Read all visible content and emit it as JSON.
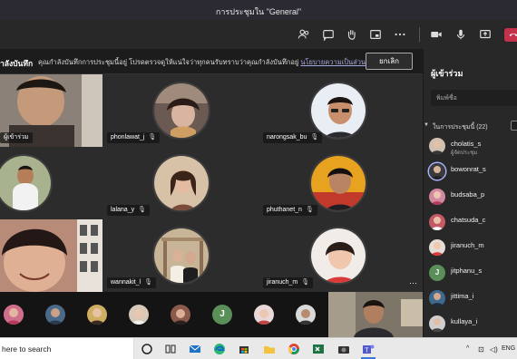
{
  "window": {
    "title": "การประชุมใน \"General\""
  },
  "toolbar": {
    "icons": [
      "participants-icon",
      "chat-icon",
      "raise-hand-icon",
      "breakout-rooms-icon",
      "more-actions-icon",
      "camera-icon",
      "microphone-icon",
      "share-screen-icon",
      "leave-call-icon"
    ],
    "hangup_color": "#c4314b"
  },
  "banner": {
    "bold_text": "ำลังบันทึก",
    "message": "คุณกำลังบันทึกการประชุมนี้อยู่ โปรดตรวจดูให้แน่ใจว่าทุกคนรับทราบว่าคุณกำลังบันทึกอยู่",
    "link": "นโยบายความเป็นส่วนตัว",
    "dismiss_label": "ยกเลิก"
  },
  "tiles": [
    {
      "name": "ผู้เข้าร่วม",
      "mic": ""
    },
    {
      "name": "phonlawat_j",
      "mic": "🎙"
    },
    {
      "name": "narongsak_bu",
      "mic": "🎙"
    },
    {
      "name": "",
      "mic": ""
    },
    {
      "name": "lalana_y",
      "mic": "🎙"
    },
    {
      "name": "phuthanet_n",
      "mic": "🎙"
    },
    {
      "name": "",
      "mic": ""
    },
    {
      "name": "wannakit_l",
      "mic": "🎙"
    },
    {
      "name": "jiranuch_m",
      "mic": "🎙",
      "more": "···"
    }
  ],
  "strip": {
    "letter_avatar": "J"
  },
  "panel": {
    "title": "ผู้เข้าร่วม",
    "search_placeholder": "พิมพ์ชื่อ",
    "section_label": "ในการประชุมนี้ (22)",
    "participants": [
      {
        "name": "cholatis_s",
        "role": "ผู้จัดประชุม"
      },
      {
        "name": "bowonrat_s",
        "role": ""
      },
      {
        "name": "budsaba_p",
        "role": ""
      },
      {
        "name": "chatsuda_c",
        "role": ""
      },
      {
        "name": "jiranuch_m",
        "role": ""
      },
      {
        "name": "jitphanu_s",
        "role": "",
        "letter": "J"
      },
      {
        "name": "jittima_i",
        "role": ""
      },
      {
        "name": "kullaya_i",
        "role": ""
      }
    ]
  },
  "taskbar": {
    "search_text": "here to search",
    "language": "ENG"
  }
}
